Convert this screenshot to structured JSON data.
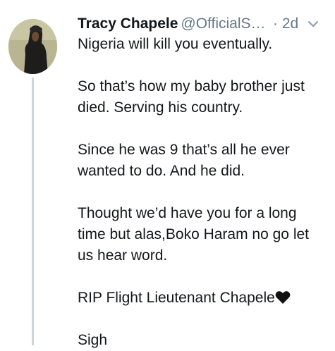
{
  "tweet": {
    "author_name": "Tracy Chapele",
    "author_handle": "@OfficialS…",
    "timestamp": "· 2d",
    "lines": {
      "l1": "Nigeria will kill you eventually.",
      "l2": "So that’s how my baby brother just",
      "l3": "died. Serving his country.",
      "l4": "Since he was 9 that’s all he ever",
      "l5": "wanted to do. And he did.",
      "l6": "Thought we’d have you for a long",
      "l7": "time but alas,Boko Haram no go let",
      "l8": "us hear word.",
      "l9": "RIP Flight Lieutenant Chapele",
      "l10": "Sigh"
    },
    "icons": {
      "heart": "black-heart-icon",
      "menu": "chevron-down-icon",
      "avatar": "avatar"
    },
    "colors": {
      "text": "#14171a",
      "secondary": "#657786",
      "thread_line": "#ccd6dd"
    }
  }
}
